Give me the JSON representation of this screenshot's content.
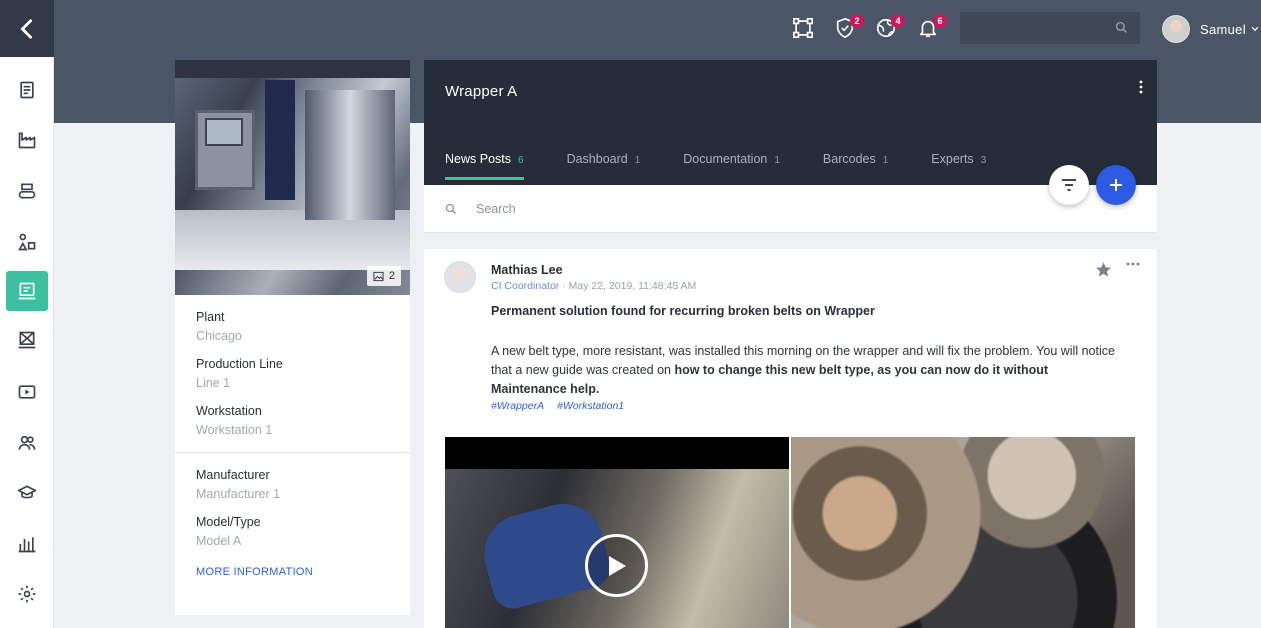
{
  "topbar": {
    "badges": {
      "shield": "2",
      "globe": "4",
      "bell": "6"
    },
    "search_placeholder": "",
    "user_name": "Samuel"
  },
  "sidebar": {
    "items": [
      {
        "icon": "document-icon"
      },
      {
        "icon": "factory-icon"
      },
      {
        "icon": "conveyor-icon"
      },
      {
        "icon": "shapes-icon"
      },
      {
        "icon": "machine-icon",
        "active": true
      },
      {
        "icon": "workstation-icon"
      },
      {
        "icon": "video-icon"
      },
      {
        "icon": "team-icon"
      },
      {
        "icon": "graduation-cap-icon"
      },
      {
        "icon": "bar-chart-icon"
      },
      {
        "icon": "gear-icon"
      }
    ]
  },
  "info": {
    "photo_count": "2",
    "plant_label": "Plant",
    "plant_value": "Chicago",
    "line_label": "Production Line",
    "line_value": "Line 1",
    "workstation_label": "Workstation",
    "workstation_value": "Workstation 1",
    "manufacturer_label": "Manufacturer",
    "manufacturer_value": "Manufacturer 1",
    "model_label": "Model/Type",
    "model_value": "Model A",
    "more_info": "MORE INFORMATION"
  },
  "main": {
    "title": "Wrapper A",
    "tabs": [
      {
        "label": "News Posts",
        "count": "6",
        "active": true
      },
      {
        "label": "Dashboard",
        "count": "1"
      },
      {
        "label": "Documentation",
        "count": "1"
      },
      {
        "label": "Barcodes",
        "count": "1"
      },
      {
        "label": "Experts",
        "count": "3"
      }
    ],
    "search_placeholder": "Search"
  },
  "post": {
    "author": "Mathias Lee",
    "role": "CI Coordinator",
    "timestamp": "May 22, 2019, 11:48:45 AM",
    "title": "Permanent solution found for recurring broken belts on Wrapper",
    "body_plain": "A new belt type, more resistant, was installed this morning on the wrapper and will fix the problem. You will notice that a new guide was created on ",
    "body_bold": "how to change this new belt type, as you can now do it without Maintenance help.",
    "tags": [
      "#WrapperA",
      "#Workstation1"
    ]
  },
  "colors": {
    "accent": "#3cc0a0",
    "primary": "#2d5be3",
    "badge": "#c8185a",
    "header": "#262d38"
  }
}
